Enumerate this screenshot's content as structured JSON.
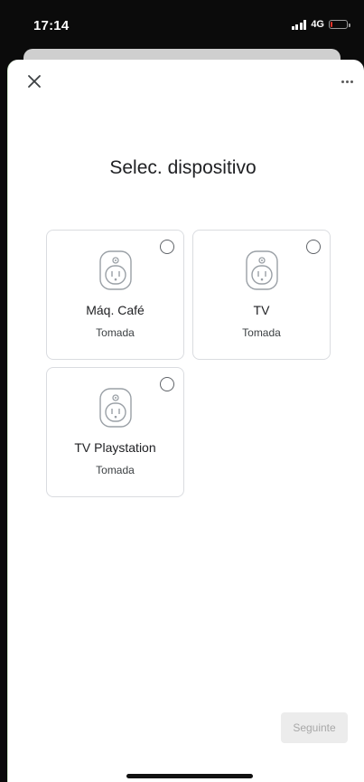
{
  "status_bar": {
    "time": "17:14",
    "network": "4G",
    "signal_icon": "signal-bars-icon",
    "battery_icon": "battery-low-icon",
    "battery_level": 0.12,
    "battery_color": "#e5342a"
  },
  "header": {
    "close_icon": "close-icon",
    "more_icon": "more-options-icon",
    "title": "Selec. dispositivo"
  },
  "devices": [
    {
      "name": "Máq. Café",
      "type": "Tomada",
      "icon": "power-outlet-icon",
      "selected": false
    },
    {
      "name": "TV",
      "type": "Tomada",
      "icon": "power-outlet-icon",
      "selected": false
    },
    {
      "name": "TV Playstation",
      "type": "Tomada",
      "icon": "power-outlet-icon",
      "selected": false
    }
  ],
  "footer": {
    "next_label": "Seguinte",
    "next_enabled": false
  },
  "colors": {
    "accent_disabled": "#ececec",
    "text_primary": "#202124",
    "card_border": "#dadce0"
  }
}
